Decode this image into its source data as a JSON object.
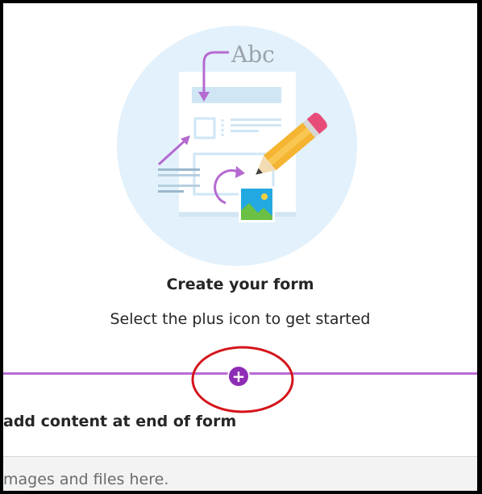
{
  "empty_state": {
    "title": "Create your form",
    "subtitle": "Select the plus icon to get started",
    "illustration_text": "Abc"
  },
  "insert_bar": {
    "icon": "plus-circle-icon",
    "accent_color": "#8e2cb6",
    "line_color": "#b96bd3",
    "label": "add content at end of form"
  },
  "annotation": {
    "color": "#d4141b"
  },
  "dropzone": {
    "text": "mages and files here."
  }
}
